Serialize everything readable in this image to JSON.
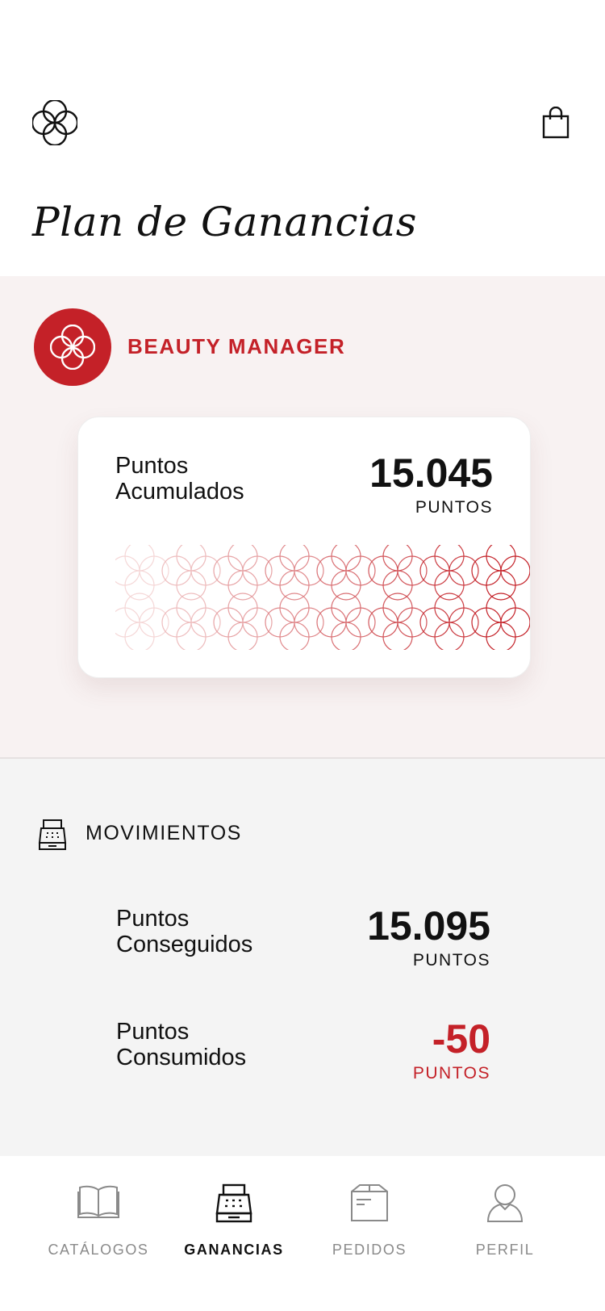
{
  "header": {
    "logo_icon": "brand-knot-icon",
    "cart_icon": "shopping-bag-icon",
    "title": "Plan de Ganancias"
  },
  "status": {
    "badge_icon": "brand-knot-icon",
    "level": "BEAUTY MANAGER",
    "card": {
      "label_line1": "Puntos",
      "label_line2": "Acumulados",
      "value": "15.045",
      "unit": "PUNTOS"
    }
  },
  "movements": {
    "icon": "cash-register-icon",
    "title": "MOVIMIENTOS",
    "rows": [
      {
        "label_line1": "Puntos",
        "label_line2": "Conseguidos",
        "value": "15.095",
        "unit": "PUNTOS",
        "color": "#111111"
      },
      {
        "label_line1": "Puntos",
        "label_line2": "Consumidos",
        "value": "-50",
        "unit": "PUNTOS",
        "color": "#c42128"
      }
    ]
  },
  "nav": {
    "items": [
      {
        "label": "CATÁLOGOS",
        "icon": "book-icon",
        "active": false
      },
      {
        "label": "GANANCIAS",
        "icon": "cash-register-icon",
        "active": true
      },
      {
        "label": "PEDIDOS",
        "icon": "box-icon",
        "active": false
      },
      {
        "label": "PERFIL",
        "icon": "user-icon",
        "active": false
      }
    ]
  },
  "colors": {
    "accent": "#c42128",
    "status_bg": "#f8f2f2",
    "movements_bg": "#f4f4f4"
  }
}
